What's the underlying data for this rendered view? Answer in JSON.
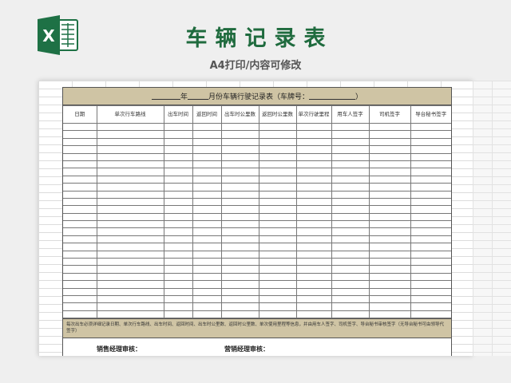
{
  "header": {
    "title": "车辆记录表",
    "subtitle": "A4打印/内容可修改",
    "app_icon": "excel-icon"
  },
  "sheet": {
    "title_parts": [
      "年",
      "月份车辆行驶记录表（车牌号：",
      "）"
    ],
    "columns": [
      "日期",
      "单次行车路线",
      "出车时间",
      "返回时间",
      "出车时公里数",
      "返回时公里数",
      "单次行驶里程",
      "用车人签字",
      "司机签字",
      "导台秘书签字"
    ],
    "empty_rows": 26,
    "note": "每次出车必须详细记录日期、单次行车路线、出车时间、返回时间、出车时公里数、返回时公里数、单次使用里程等信息，并由用车人签字、司机签字、导台秘书审核签字（无导台秘书可由领导代签字）",
    "signatures": [
      "销售经理审核：",
      "营销经理审核："
    ]
  },
  "colors": {
    "brand": "#1f6b3e",
    "header_fill": "#cfc4a4",
    "excel_green": "#1e7145"
  }
}
